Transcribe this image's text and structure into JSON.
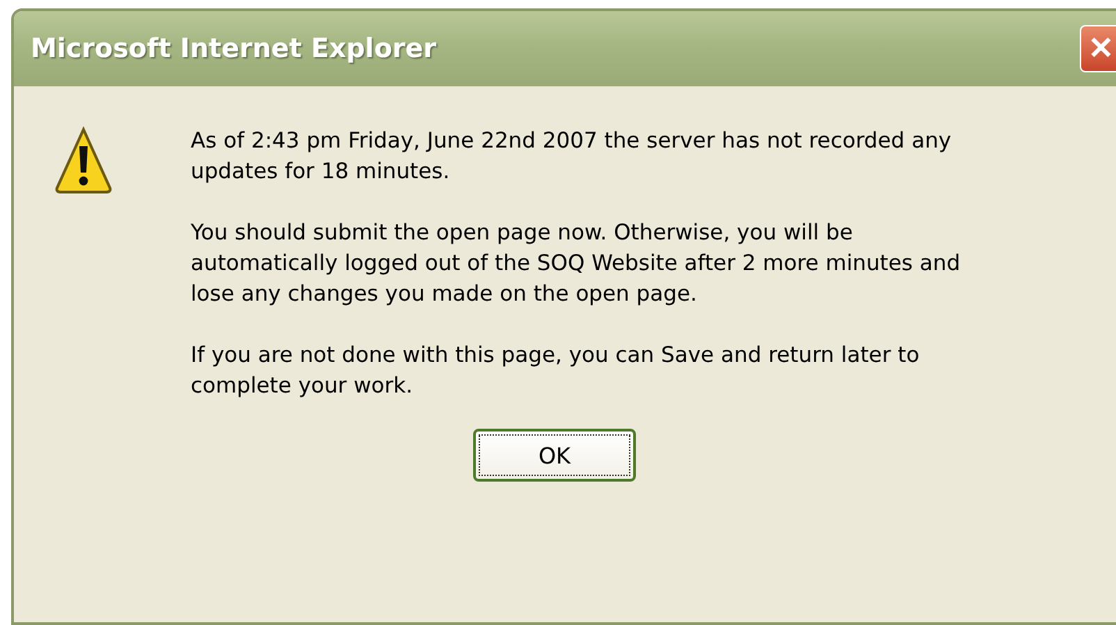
{
  "window": {
    "title": "Microsoft Internet Explorer",
    "close_button": "✕"
  },
  "message": {
    "paragraphs": [
      "As of 2:43 pm Friday, June 22nd 2007 the server has not recorded any updates for 18 minutes.",
      "You should submit the open page now. Otherwise, you will be automatically logged out of the SOQ Website after 2 more minutes and lose any changes you made on the open page.",
      "If you are not done with this page, you can Save and return later to complete your work."
    ]
  },
  "buttons": [
    {
      "label": "OK",
      "focused": true
    }
  ]
}
